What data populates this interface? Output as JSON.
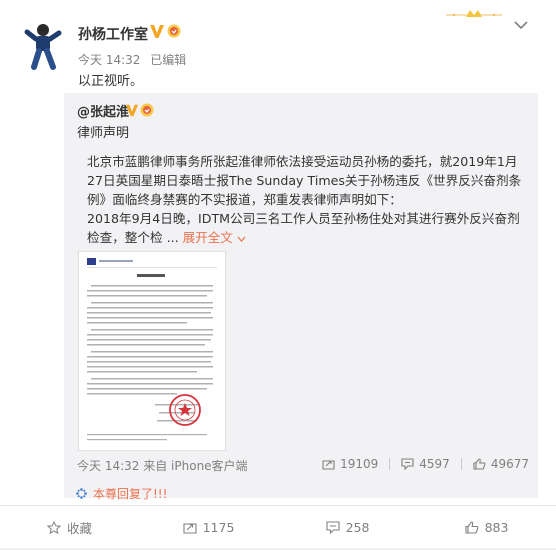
{
  "post": {
    "author": "孙杨工作室",
    "time": "今天 14:32",
    "edited": "已编辑",
    "text": "以正视听。"
  },
  "repost": {
    "author": "@张起淮",
    "title": "律师声明",
    "para1": "北京市蓝鹏律师事务所张起淮律师依法接受运动员孙杨的委托，就2019年1月27日英国星期日泰晤士报The Sunday Times关于孙杨违反《世界反兴奋剂条例》面临终身禁赛的不实报道，郑重发表律师声明如下：",
    "para2": "2018年9月4日晚，IDTM公司三名工作人员至孙杨住处对其进行赛外反兴奋剂检查，整个检 ...",
    "expand": "展开全文",
    "time": "今天 14:32",
    "source": "来自 iPhone客户端",
    "reposts": "19109",
    "comments": "4597",
    "likes": "49677"
  },
  "replied_label": "本尊回复了!!!",
  "actions": {
    "favorite": "收藏",
    "repost": "1175",
    "comment": "258",
    "like": "883"
  },
  "colors": {
    "link": "#eb7350",
    "gray": "#808080",
    "v_badge": "#f5a623"
  },
  "icons": [
    "chevron-down-icon",
    "crown-deco-icon",
    "vip-badge-icon",
    "star-icon",
    "repost-icon",
    "comment-icon",
    "like-icon",
    "sparkle-icon"
  ]
}
